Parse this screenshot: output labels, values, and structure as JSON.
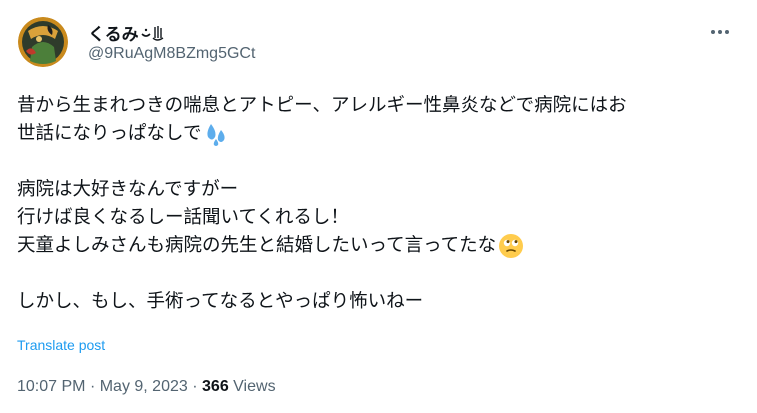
{
  "author": {
    "display_name": "くるみ",
    "handle": "@9RuAgM8BZmg5GCt",
    "avatar_icon": "profile-avatar",
    "name_emoji_icon": "hand-emoji-icon"
  },
  "menu_icon": "more-dots-icon",
  "tweet": {
    "lines": [
      "昔から生まれつきの喘息とアトピー、アレルギー性鼻炎などで病院にはお",
      "世話になりっぱなしで",
      "",
      "病院は大好きなんですがー",
      "行けば良くなるしー話聞いてくれるし！",
      "天童よしみさんも病院の先生と結婚したいって言ってたな",
      "",
      "しかし、もし、手術ってなるとやっぱり怖いねー"
    ],
    "emojis": [
      "sweat-droplets-emoji",
      "face-with-rolling-eyes-emoji"
    ]
  },
  "translate_label": "Translate post",
  "meta": {
    "time": "10:07 PM",
    "separator": "·",
    "date": "May 9, 2023",
    "views_count": "366",
    "views_label": "Views"
  },
  "colors": {
    "text_primary": "#0f1419",
    "text_secondary": "#536471",
    "link": "#1d9bf0"
  }
}
